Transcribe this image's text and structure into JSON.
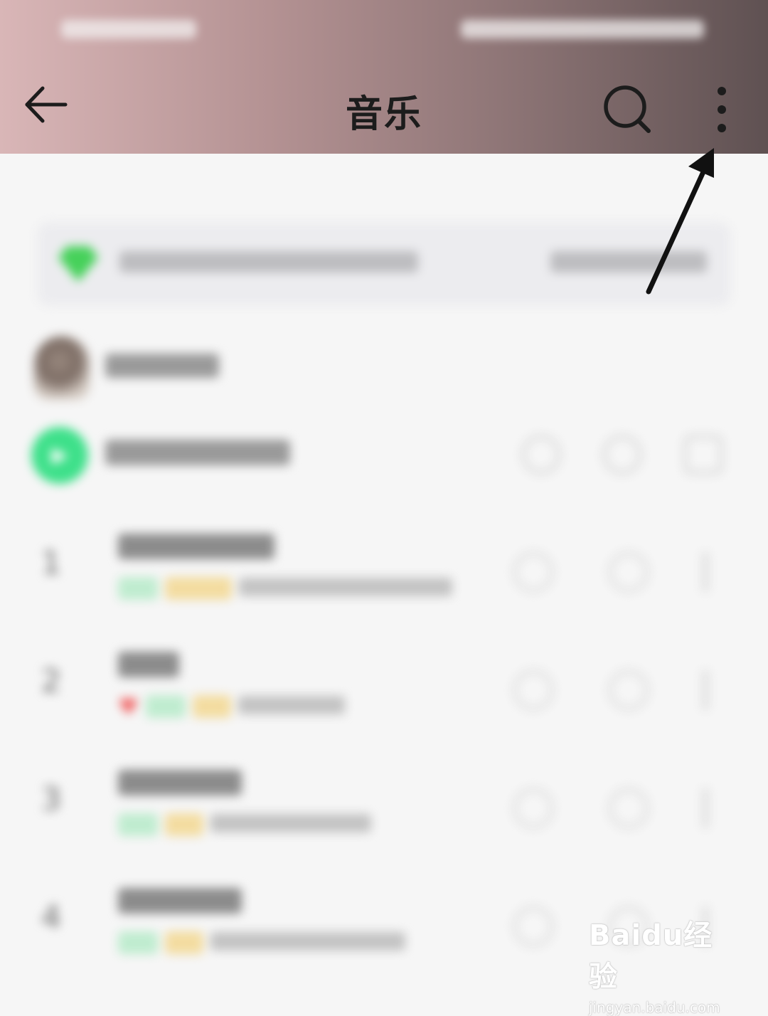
{
  "header": {
    "title": "音乐",
    "back_icon": "arrow-left-icon",
    "search_icon": "search-icon",
    "more_icon": "more-vertical-icon",
    "gradient": [
      "#d9b6b7",
      "#5f5152"
    ]
  },
  "watermark": {
    "main": "Baidu经验",
    "sub": "jingyan.baidu.com"
  },
  "colors": {
    "accent_green": "#3ee08a",
    "annotation_arrow": "#111111"
  }
}
